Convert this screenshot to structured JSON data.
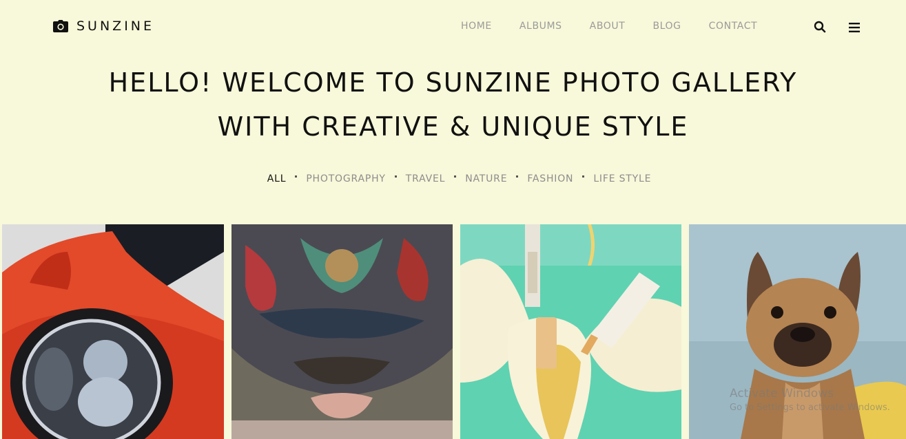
{
  "header": {
    "brand": "SUNZINE",
    "logo_icon": "camera-icon",
    "nav": [
      "HOME",
      "ALBUMS",
      "ABOUT",
      "BLOG",
      "CONTACT"
    ],
    "search_icon": "search-icon",
    "menu_icon": "hamburger-menu-icon"
  },
  "hero": {
    "line1": "HELLO! WELCOME TO SUNZINE PHOTO GALLERY",
    "line2": "WITH CREATIVE & UNIQUE STYLE"
  },
  "filters": {
    "active": "ALL",
    "items": [
      "ALL",
      "PHOTOGRAPHY",
      "TRAVEL",
      "NATURE",
      "FASHION",
      "LIFE STYLE"
    ]
  },
  "gallery": {
    "photos": [
      "red-car-headlight",
      "tattooed-head",
      "banana-cigarettes",
      "french-bulldog"
    ]
  },
  "os_watermark": {
    "line1": "Activate Windows",
    "line2": "Go to Settings to activate Windows."
  },
  "colors": {
    "background": "#f8f8da",
    "text_dark": "#111111",
    "text_muted": "#9a9a9a"
  }
}
